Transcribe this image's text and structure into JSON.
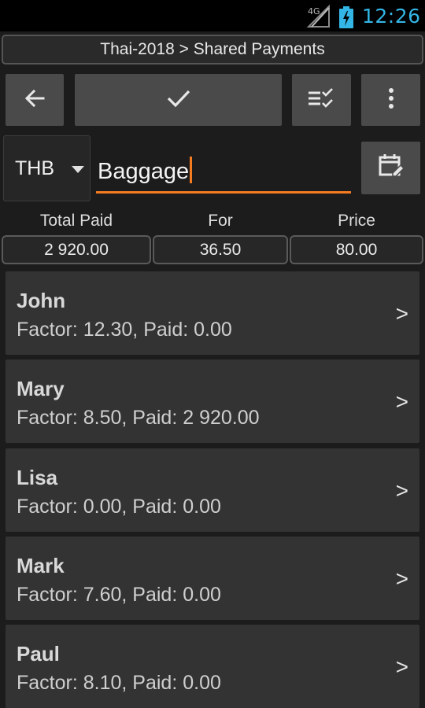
{
  "status_bar": {
    "network_label": "4G",
    "network_icon": "signal-icon",
    "battery_icon": "battery-charging-icon",
    "time": "12:26",
    "accent_color": "#33b5e5"
  },
  "breadcrumb": "Thai-2018 > Shared Payments",
  "toolbar": {
    "back_icon": "arrow-left-icon",
    "confirm_icon": "check-icon",
    "checklist_icon": "checklist-icon",
    "more_icon": "more-vertical-icon"
  },
  "form": {
    "currency": "THB",
    "name_value": "Baggage",
    "calendar_icon": "calendar-edit-icon",
    "accent_color": "#f47b20"
  },
  "summary": {
    "total_paid_label": "Total Paid",
    "total_paid_value": "2 920.00",
    "for_label": "For",
    "for_value": "36.50",
    "price_label": "Price",
    "price_value": "80.00"
  },
  "people": [
    {
      "name": "John",
      "detail": "Factor: 12.30, Paid: 0.00",
      "chevron": ">"
    },
    {
      "name": "Mary",
      "detail": "Factor: 8.50, Paid: 2 920.00",
      "chevron": ">"
    },
    {
      "name": "Lisa",
      "detail": "Factor: 0.00, Paid: 0.00",
      "chevron": ">"
    },
    {
      "name": "Mark",
      "detail": "Factor: 7.60, Paid: 0.00",
      "chevron": ">"
    },
    {
      "name": "Paul",
      "detail": "Factor: 8.10, Paid: 0.00",
      "chevron": ">"
    }
  ]
}
